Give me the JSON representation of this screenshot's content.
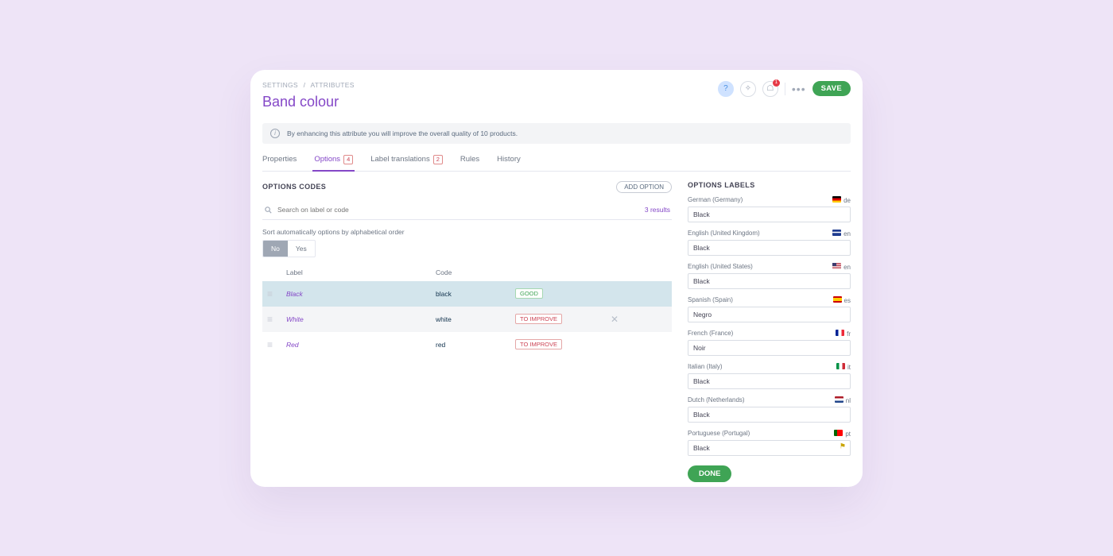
{
  "breadcrumb": {
    "b1": "SETTINGS",
    "b2": "ATTRIBUTES"
  },
  "page_title": "Band colour",
  "actions": {
    "save": "SAVE",
    "notif_count": "1"
  },
  "banner": "By enhancing this attribute you will improve the overall quality of 10 products.",
  "tabs": {
    "properties": "Properties",
    "options": "Options",
    "options_badge": "4",
    "label_trans": "Label translations",
    "label_trans_badge": "2",
    "rules": "Rules",
    "history": "History"
  },
  "left": {
    "section": "OPTIONS CODES",
    "add_option": "ADD OPTION",
    "search_placeholder": "Search on label or code",
    "results": "3 results",
    "sort_hint": "Sort automatically options by alphabetical order",
    "toggle_no": "No",
    "toggle_yes": "Yes",
    "col_label": "Label",
    "col_code": "Code",
    "rows": [
      {
        "label": "Black",
        "code": "black",
        "quality": "GOOD",
        "selected": true,
        "hover": false
      },
      {
        "label": "White",
        "code": "white",
        "quality": "TO IMPROVE",
        "selected": false,
        "hover": true
      },
      {
        "label": "Red",
        "code": "red",
        "quality": "TO IMPROVE",
        "selected": false,
        "hover": false
      }
    ]
  },
  "right": {
    "section": "OPTIONS LABELS",
    "langs": [
      {
        "name": "German (Germany)",
        "code": "de",
        "flag": "f-de",
        "value": "Black"
      },
      {
        "name": "English (United Kingdom)",
        "code": "en",
        "flag": "f-en",
        "value": "Black"
      },
      {
        "name": "English (United States)",
        "code": "en",
        "flag": "f-us",
        "value": "Black"
      },
      {
        "name": "Spanish (Spain)",
        "code": "es",
        "flag": "f-es",
        "value": "Negro"
      },
      {
        "name": "French (France)",
        "code": "fr",
        "flag": "f-fr",
        "value": "Noir"
      },
      {
        "name": "Italian (Italy)",
        "code": "it",
        "flag": "f-it",
        "value": "Black"
      },
      {
        "name": "Dutch (Netherlands)",
        "code": "nl",
        "flag": "f-nl",
        "value": "Black"
      },
      {
        "name": "Portuguese (Portugal)",
        "code": "pt",
        "flag": "f-pt",
        "value": "Black",
        "warn": true
      }
    ],
    "done": "DONE"
  }
}
